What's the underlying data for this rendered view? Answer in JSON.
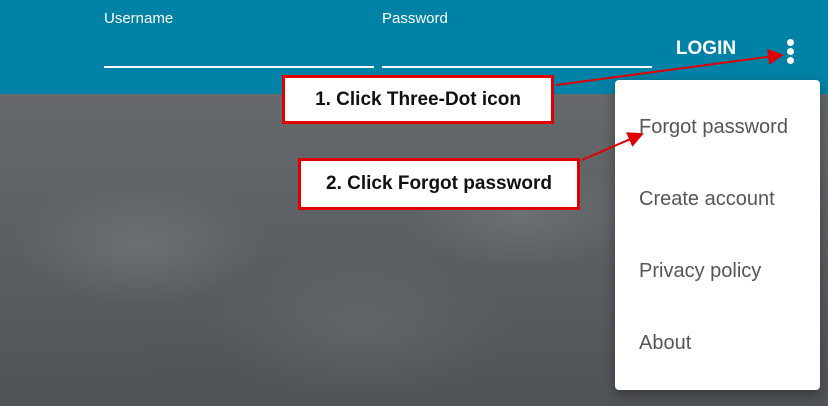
{
  "header": {
    "username_label": "Username",
    "username_value": "",
    "password_label": "Password",
    "password_value": "",
    "login_label": "LOGIN",
    "more_icon": "three-dot-vertical-icon"
  },
  "menu": {
    "items": [
      {
        "label": "Forgot password"
      },
      {
        "label": "Create account"
      },
      {
        "label": "Privacy policy"
      },
      {
        "label": "About"
      }
    ]
  },
  "annotations": {
    "step1": "1. Click Three-Dot icon",
    "step2": "2. Click Forgot password"
  },
  "colors": {
    "header_bg": "#0082a6",
    "callout_border": "#e00000",
    "arrow": "#e00000"
  }
}
